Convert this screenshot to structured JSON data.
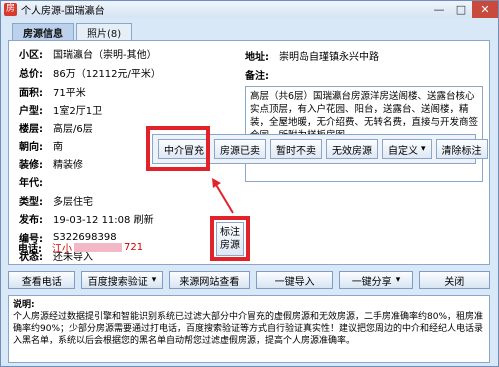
{
  "window": {
    "title": "个人房源-国瑞瀛台",
    "icon_text": "房",
    "min": "—",
    "max": "□",
    "close": "✕"
  },
  "tabs": [
    {
      "label": "房源信息",
      "active": true
    },
    {
      "label": "照片(8)",
      "active": false
    }
  ],
  "details": {
    "community_label": "小区:",
    "community_value": "国瑞瀛台（崇明-其他）",
    "price_label": "总价:",
    "price_value": "86万（12112元/平米）",
    "area_label": "面积:",
    "area_value": "71平米",
    "layout_label": "户型:",
    "layout_value": "1室2厅1卫",
    "floor_label": "楼层:",
    "floor_value": "高层/6层",
    "facing_label": "朝向:",
    "facing_value": "南",
    "decor_label": "装修:",
    "decor_value": "精装修",
    "year_label": "年代:",
    "year_value": "",
    "type_label": "类型:",
    "type_value": "多层住宅",
    "publish_label": "发布:",
    "publish_value": "19-03-12 11:08 刷新",
    "number_label": "编号:",
    "number_value": "S322698398",
    "status_label": "状态:",
    "status_value": "还未导入",
    "phone_label": "电话:",
    "phone_prefix": "江小",
    "phone_suffix": "721"
  },
  "address": {
    "label": "地址:",
    "value": "崇明岛自瑾镇永兴中路"
  },
  "notes": {
    "label": "备注:",
    "text": "高层（共6层）国瑞瀛台房源洋房送阁楼、送露台核心实点顶层，有入户花园、阳台，送露台、送阁楼，精装，全屋地暖，无介绍费、无转名费，直接与开发商签合同。所附为样板房图。"
  },
  "actions": {
    "agent_fake": "中介冒充",
    "sold": "房源已卖",
    "not_selling": "暂时不卖",
    "invalid": "无效房源",
    "custom": "自定义",
    "clear_tags": "清除标注",
    "tag_house_line1": "标注",
    "tag_house_line2": "房源"
  },
  "bottom": {
    "view_phone": "查看电话",
    "baidu_verify": "百度搜索验证",
    "view_source": "来源网站查看",
    "import": "一键导入",
    "share": "一键分享",
    "close": "关闭"
  },
  "explanation": {
    "title": "说明:",
    "text": "个人房源经过数据提引擎和智能识别系统已过滤大部分中介冒充的虚假房源和无效房源，二手房准确率约80%，租房准确率约90%；少部分房源需要通过打电话，百度搜索验证等方式自行验证真实性！建议把您周边的中介和经纪人电话录入黑名单，系统以后会根据您的黑名单自动帮您过滤虚假房源，提高个人房源准确率。"
  },
  "colors": {
    "highlight": "#e2222a",
    "phone": "#d00000",
    "chrome": "#d9e8f6"
  }
}
